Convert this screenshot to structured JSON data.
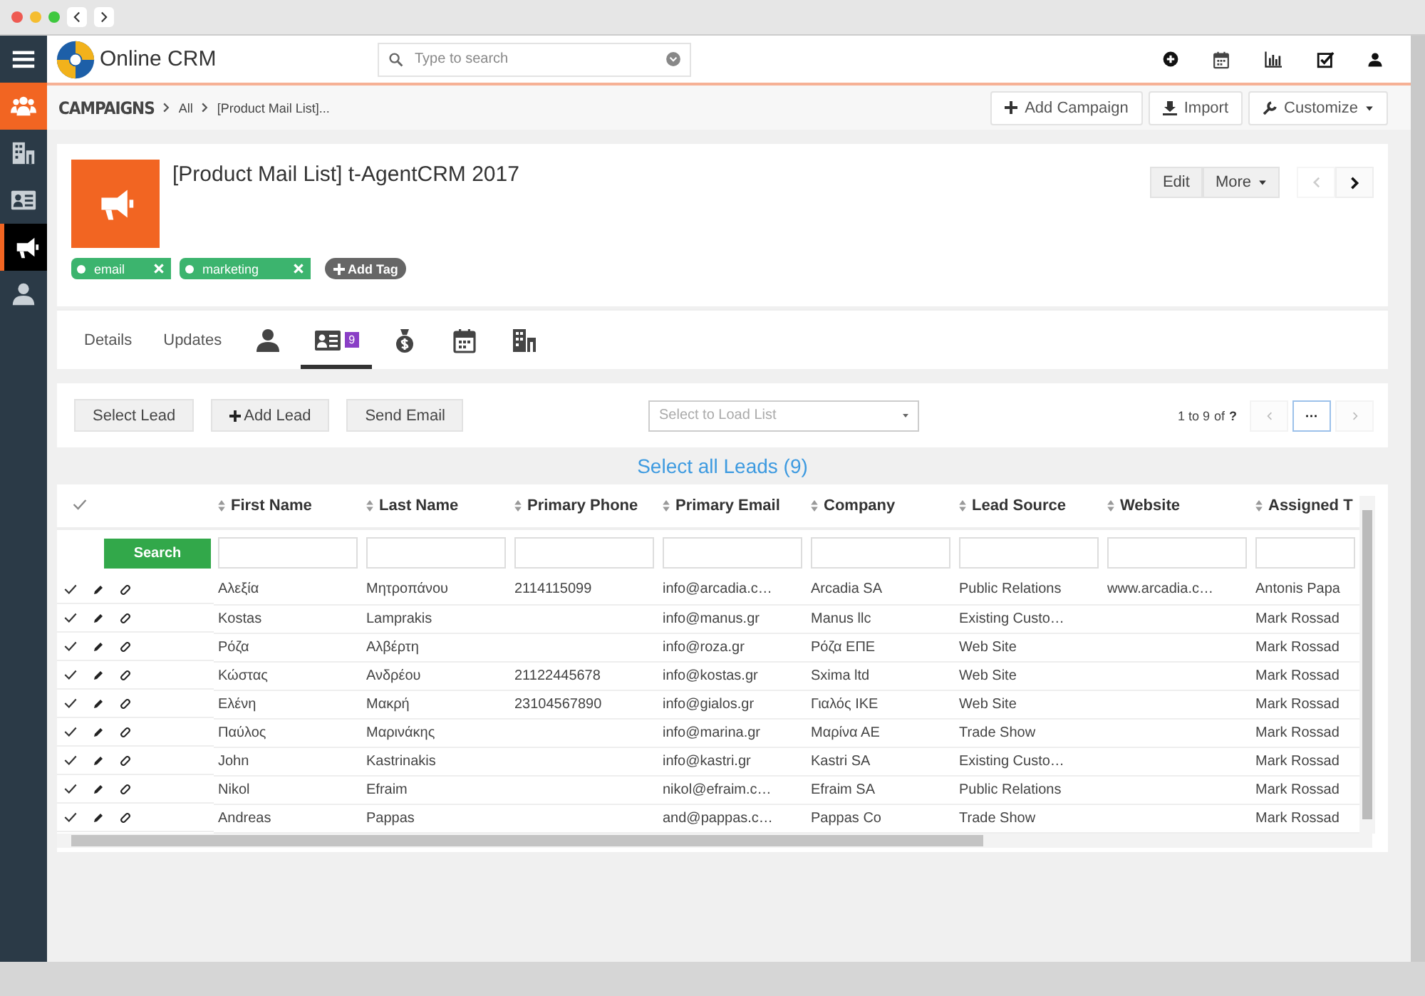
{
  "sidebar": {
    "items": [
      {
        "kind": "menu",
        "selected": false,
        "highlighted": false
      },
      {
        "kind": "module",
        "selected": false,
        "highlighted": true
      },
      {
        "kind": "module",
        "selected": false,
        "highlighted": false
      },
      {
        "kind": "module",
        "selected": false,
        "highlighted": false
      },
      {
        "kind": "module",
        "selected": true,
        "highlighted": false
      },
      {
        "kind": "module",
        "selected": false,
        "highlighted": false
      }
    ]
  },
  "header": {
    "logo": "Online CRM",
    "search": {
      "placeholder": "Type to search"
    }
  },
  "breadcrumb": [
    "CAMPAIGNS",
    "All",
    "[Product Mail List]..."
  ],
  "actions": [
    {
      "label": "Add Campaign",
      "kind": "add"
    },
    {
      "label": "Import",
      "kind": "import"
    },
    {
      "label": "Customize",
      "kind": "customize"
    }
  ],
  "record": {
    "title": "[Product Mail List] t-AgentCRM 2017",
    "tags": [
      {
        "label": "email"
      },
      {
        "label": "marketing"
      }
    ],
    "add_tag": "Add Tag",
    "buttons": [
      "Edit",
      "More"
    ],
    "prev_disabled": true
  },
  "tabs": [
    {
      "kind": "text",
      "label": "Details",
      "selected": false
    },
    {
      "kind": "text",
      "label": "Updates",
      "selected": false
    },
    {
      "kind": "icon",
      "selected": false
    },
    {
      "kind": "icon",
      "badge": "9",
      "selected": true
    },
    {
      "kind": "icon",
      "selected": false
    },
    {
      "kind": "icon",
      "selected": false
    },
    {
      "kind": "icon",
      "selected": false
    }
  ],
  "toolbar": {
    "buttons": [
      {
        "label": "Select Lead",
        "kind": "plain"
      },
      {
        "label": "Add Lead",
        "kind": "add"
      },
      {
        "label": "Send Email",
        "kind": "plain"
      }
    ],
    "list_select": {
      "placeholder": "Select to Load List"
    },
    "pager": {
      "range": "1 to 9",
      "of": "of",
      "total": "?",
      "more": "···"
    }
  },
  "select_all": "Select all Leads (9)",
  "table": {
    "all_checked": true,
    "search_button": "Search",
    "columns": [
      "First Name",
      "Last Name",
      "Primary Phone",
      "Primary Email",
      "Company",
      "Lead Source",
      "Website",
      "Assigned T"
    ],
    "rows": [
      {
        "checked": true,
        "cells": [
          "Αλεξία",
          "Μητροπάνου",
          "2114115099",
          "info@arcadia.c…",
          "Arcadia SA",
          "Public Relations",
          "www.arcadia.c…",
          "Antonis Papa"
        ]
      },
      {
        "checked": true,
        "cells": [
          "Kostas",
          "Lamprakis",
          "",
          "info@manus.gr",
          "Manus llc",
          "Existing Custo…",
          "",
          "Mark Rossad"
        ]
      },
      {
        "checked": true,
        "cells": [
          "Ρόζα",
          "Αλβέρτη",
          "",
          "info@roza.gr",
          "Ρόζα ΕΠΕ",
          "Web Site",
          "",
          "Mark Rossad"
        ]
      },
      {
        "checked": true,
        "cells": [
          "Κώστας",
          "Ανδρέου",
          "21122445678",
          "info@kostas.gr",
          "Sxima ltd",
          "Web Site",
          "",
          "Mark Rossad"
        ]
      },
      {
        "checked": true,
        "cells": [
          "Ελένη",
          "Μακρή",
          "23104567890",
          "info@gialos.gr",
          "Γιαλός ΙΚΕ",
          "Web Site",
          "",
          "Mark Rossad"
        ]
      },
      {
        "checked": true,
        "cells": [
          "Παύλος",
          "Μαρινάκης",
          "",
          "info@marina.gr",
          "Μαρίνα ΑΕ",
          "Trade Show",
          "",
          "Mark Rossad"
        ]
      },
      {
        "checked": true,
        "cells": [
          "John",
          "Kastrinakis",
          "",
          "info@kastri.gr",
          "Kastri SA",
          "Existing Custo…",
          "",
          "Mark Rossad"
        ]
      },
      {
        "checked": true,
        "cells": [
          "Nikol",
          "Efraim",
          "",
          "nikol@efraim.c…",
          "Efraim SA",
          "Public Relations",
          "",
          "Mark Rossad"
        ]
      },
      {
        "checked": true,
        "cells": [
          "Andreas",
          "Pappas",
          "",
          "and@pappas.c…",
          "Pappas Co",
          "Trade Show",
          "",
          "Mark Rossad"
        ]
      }
    ]
  }
}
